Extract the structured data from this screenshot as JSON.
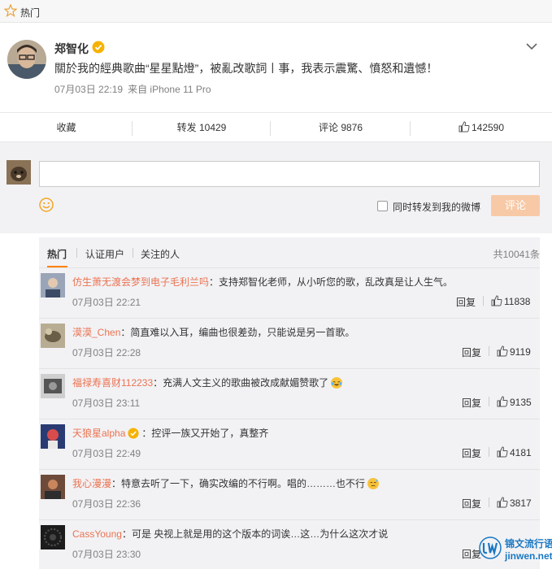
{
  "topbar": {
    "title": "热门"
  },
  "post": {
    "author": "郑智化",
    "text": "關於我的經典歌曲“星星點燈”，被亂改歌詞丨事，我表示震驚、憤怒和遺憾！",
    "time": "07月03日 22:19",
    "source": "来自 iPhone 11 Pro"
  },
  "actions": {
    "favorite": "收藏",
    "repost": "转发 10429",
    "comment": "评论 9876",
    "likes": "142590"
  },
  "compose": {
    "input_value": "",
    "repost_label": "同时转发到我的微博",
    "submit_label": "评论",
    "submit_color": "#f8c9a6"
  },
  "comments": {
    "tabs": [
      "热门",
      "认证用户",
      "关注的人"
    ],
    "total": "共10041条",
    "reply_label": "回复",
    "list": [
      {
        "user": "仿生萧无渡会梦到电子毛利兰吗",
        "text": "：支持郑智化老师，从小听您的歌，乱改真是让人生气。",
        "time": "07月03日 22:21",
        "likes": "11838"
      },
      {
        "user": "漠漠_Chen",
        "text": "：简直难以入耳，编曲也很差劲，只能说是另一首歌。",
        "time": "07月03日 22:28",
        "likes": "9119"
      },
      {
        "user": "福禄寿喜财112233",
        "text": "：充满人文主义的歌曲被改成献媚赞歌了",
        "time": "07月03日 23:11",
        "likes": "9135",
        "emoji": "laugh-cry-emoji"
      },
      {
        "user": "天狼星alpha",
        "text": "：控评一族又开始了，真整齐",
        "time": "07月03日 22:49",
        "likes": "4181",
        "verified": true
      },
      {
        "user": "我心漫漫",
        "text": "：特意去听了一下，确实改编的不行啊。唱的………也不行",
        "time": "07月03日 22:36",
        "likes": "3817",
        "emoji": "sweat-emoji"
      },
      {
        "user": "CassYoung",
        "text": "：可是 央视上就是用的这个版本的词诶…这…为什么这次才说",
        "time": "07月03日 23:30",
        "likes": ""
      }
    ]
  },
  "watermark": {
    "line1": "锦文流行语",
    "line2": "jinwen.net"
  },
  "colors": {
    "accent": "#ff8200",
    "username": "#eb7350",
    "watermark": "#1a78c2"
  }
}
